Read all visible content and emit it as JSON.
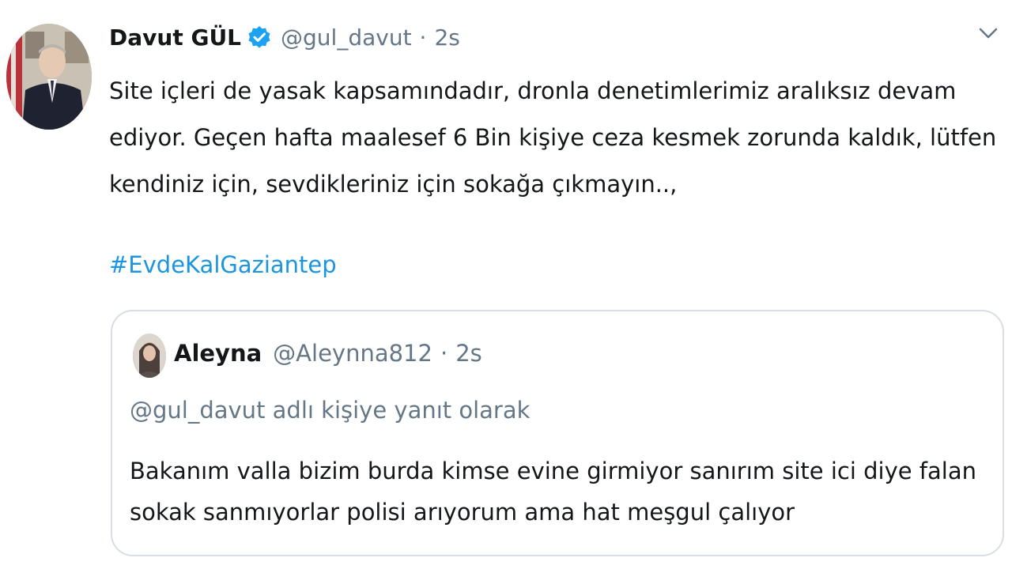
{
  "tweet": {
    "author_name": "Davut GÜL",
    "author_handle": "@gul_davut",
    "separator": "·",
    "time": "2s",
    "verified": true,
    "avatar_icon": "profile-photo",
    "menu_icon": "chevron-down-icon",
    "text_lines": [
      "Site içleri de yasak kapsamındadır, dronla denetimlerimiz aralıksız devam",
      "ediyor. Geçen hafta maalesef 6 Bin kişiye ceza kesmek zorunda kaldık, lütfen",
      "kendiniz için, sevdikleriniz için sokağa çıkmayın..,"
    ],
    "hashtag": "#EvdeKalGaziantep"
  },
  "quote": {
    "author_name": "Aleyna",
    "author_handle": "@Aleynna812",
    "separator": "·",
    "time": "2s",
    "reply_context": "@gul_davut adlı kişiye yanıt olarak",
    "text_lines": [
      "Bakanım valla bizim burda kimse evine girmiyor sanırım site ici diye falan",
      "sokak sanmıyorlar polisi arıyorum ama hat meşgul çalıyor"
    ]
  },
  "colors": {
    "link": "#1b95e0",
    "muted": "#657786",
    "text": "#14171a",
    "verified_badge": "#1da1f2",
    "border": "#d8dee3"
  }
}
